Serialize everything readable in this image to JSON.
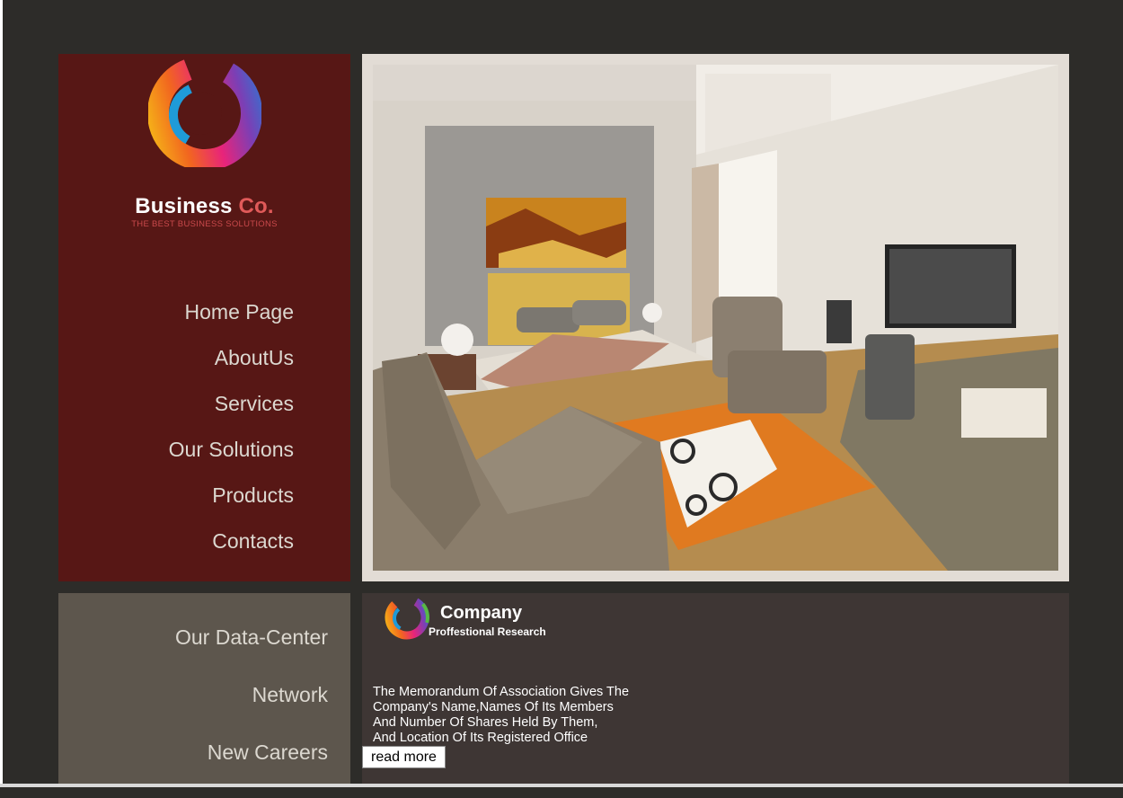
{
  "brand": {
    "name_main": "Business",
    "name_accent": "Co.",
    "tagline": "THE BEST BUSINESS SOLUTIONS",
    "logo_icon": "swirl-logo-icon"
  },
  "nav": {
    "items": [
      "Home Page",
      "AboutUs",
      "Services",
      "Our Solutions",
      "Products",
      "Contacts"
    ]
  },
  "hero": {
    "image": "bedroom-interior-photo"
  },
  "secondary_nav": {
    "items": [
      "Our Data-Center",
      "Network",
      "New Careers"
    ]
  },
  "company": {
    "title": "Company",
    "subtitle": "Proffestional Research",
    "lines": [
      "The Memorandum Of Association Gives The",
      "Company's Name,Names Of Its Members",
      "And Number Of Shares Held By Them,",
      "And Location Of Its Registered Office"
    ],
    "read_more": "read more"
  },
  "colors": {
    "page_bg": "#2d2c29",
    "sidebar_top": "#571715",
    "sidebar_bottom": "#5d564d",
    "company_panel": "#3e3634",
    "brand_accent": "#e05a59",
    "nav_text": "#dcd8d0"
  }
}
